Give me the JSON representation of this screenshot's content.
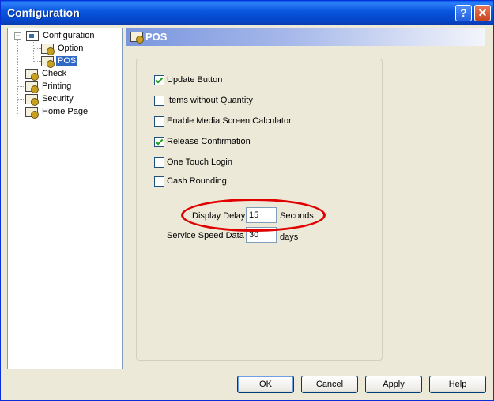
{
  "window": {
    "title": "Configuration"
  },
  "titlebar_buttons": {
    "help": "?",
    "close": "✕"
  },
  "tree": {
    "expander": "−",
    "items": [
      {
        "label": "Configuration",
        "icon": "config-root-icon"
      },
      {
        "label": "Option",
        "icon": "gear-page-icon"
      },
      {
        "label": "POS",
        "icon": "gear-page-icon",
        "selected": true
      },
      {
        "label": "Check",
        "icon": "gear-page-icon"
      },
      {
        "label": "Printing",
        "icon": "gear-page-icon"
      },
      {
        "label": "Security",
        "icon": "gear-page-icon"
      },
      {
        "label": "Home Page",
        "icon": "gear-page-icon"
      }
    ]
  },
  "panel": {
    "title": "POS",
    "checkboxes": [
      {
        "label": "Update Button",
        "checked": true
      },
      {
        "label": "Items without Quantity",
        "checked": false
      },
      {
        "label": "Enable Media Screen Calculator",
        "checked": false
      },
      {
        "label": "Release Confirmation",
        "checked": true
      },
      {
        "label": "One Touch Login",
        "checked": false
      },
      {
        "label": "Cash Rounding",
        "checked": false
      }
    ],
    "display_delay": {
      "label": "Display Delay",
      "value": "15",
      "unit": "Seconds"
    },
    "service_speed": {
      "label": "Service Speed Data",
      "value": "30",
      "unit": "days"
    }
  },
  "buttons": {
    "ok": "OK",
    "cancel": "Cancel",
    "apply": "Apply",
    "help": "Help"
  },
  "annotation_color": "#e00000"
}
